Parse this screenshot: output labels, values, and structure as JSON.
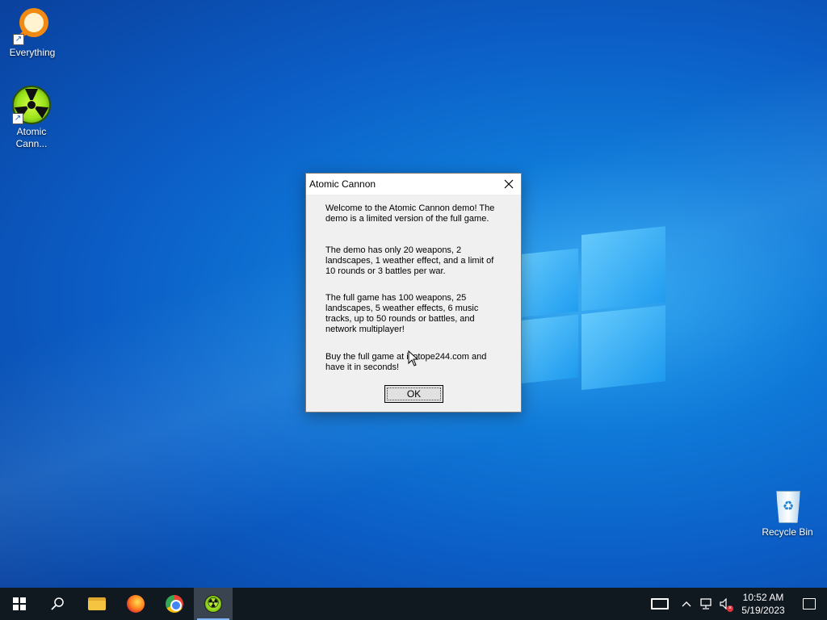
{
  "desktop": {
    "icons": [
      {
        "label": "Everything",
        "icon": "everything-search-icon"
      },
      {
        "label": "Atomic\nCann...",
        "icon": "radiation-icon"
      },
      {
        "label": "Recycle Bin",
        "icon": "recycle-bin-icon"
      }
    ]
  },
  "dialog": {
    "title": "Atomic Cannon",
    "paragraphs": [
      "Welcome to the Atomic Cannon demo!  The demo is a limited version of the full game.",
      "The demo has only 20 weapons, 2 landscapes, 1 weather effect, and a limit of 10 rounds or 3 battles per war.",
      "The full game has 100 weapons, 25 landscapes, 5 weather effects, 6 music tracks, up to 50 rounds or battles,  and network multiplayer!",
      "Buy the full game at isotope244.com and have it in seconds!"
    ],
    "ok_label": "OK"
  },
  "taskbar": {
    "items": [
      "start-icon",
      "search-icon",
      "file-explorer-icon",
      "firefox-icon",
      "chrome-icon",
      "atomic-cannon-icon"
    ],
    "clock_time": "10:52 AM",
    "clock_date": "5/19/2023"
  }
}
